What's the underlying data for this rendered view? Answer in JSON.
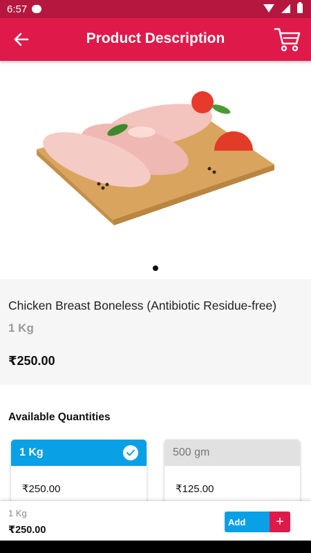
{
  "status_bar": {
    "time": "6:57"
  },
  "header": {
    "title": "Product Description"
  },
  "product": {
    "name": "Chicken Breast Boneless  (Antibiotic Residue-free)",
    "unit": "1 Kg",
    "price": "₹250.00"
  },
  "quantities": {
    "heading": "Available Quantities",
    "options": [
      {
        "label": "1 Kg",
        "price": "₹250.00",
        "selected": true
      },
      {
        "label": "500 gm",
        "price": "₹125.00",
        "selected": false
      }
    ]
  },
  "bottom_bar": {
    "unit": "1 Kg",
    "price": "₹250.00",
    "add_label": "Add",
    "plus_label": "+"
  },
  "colors": {
    "primary": "#e0194b",
    "status_bar": "#b5173f",
    "accent_blue": "#0aa0e6"
  },
  "icons": [
    "back-arrow-icon",
    "cart-icon",
    "check-icon",
    "plus-icon",
    "wifi-icon",
    "signal-icon",
    "battery-icon",
    "message-icon"
  ]
}
